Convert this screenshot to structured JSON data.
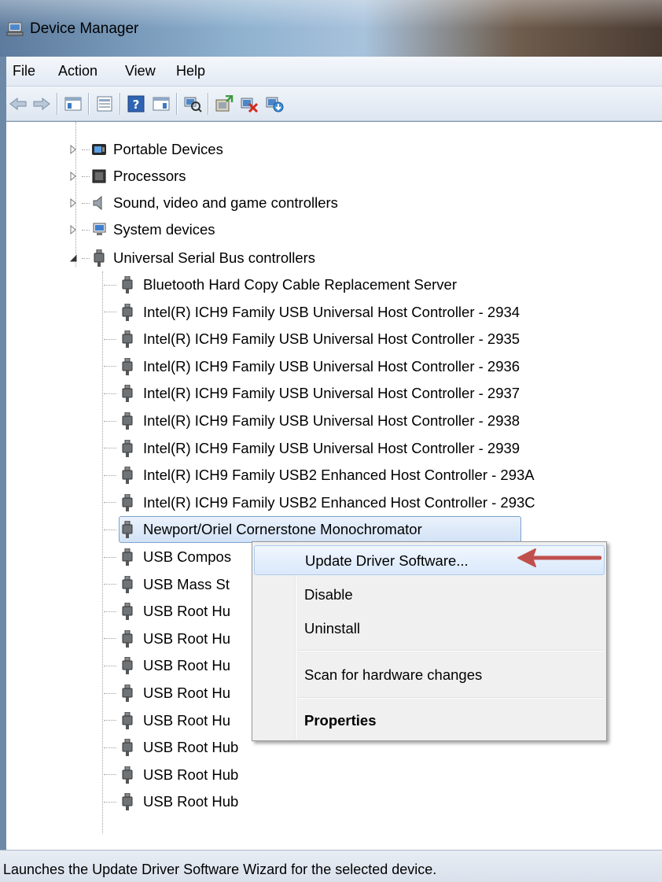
{
  "window": {
    "title": "Device Manager"
  },
  "menubar": {
    "items": [
      "File",
      "Action",
      "View",
      "Help"
    ]
  },
  "toolbar": {
    "buttons": [
      "back-icon",
      "forward-icon",
      "show-hide-console-tree-icon",
      "properties-icon",
      "help-icon",
      "action-pane-icon",
      "scan-hardware-icon",
      "update-driver-icon",
      "uninstall-icon",
      "enable-device-icon"
    ]
  },
  "tree": {
    "categories": [
      {
        "label": "Portable Devices",
        "expanded": false
      },
      {
        "label": "Processors",
        "expanded": false
      },
      {
        "label": "Sound, video and game controllers",
        "expanded": false
      },
      {
        "label": "System devices",
        "expanded": false
      },
      {
        "label": "Universal Serial Bus controllers",
        "expanded": true
      }
    ],
    "usb_devices": [
      "Bluetooth Hard Copy Cable Replacement Server",
      "Intel(R) ICH9 Family USB Universal Host Controller - 2934",
      "Intel(R) ICH9 Family USB Universal Host Controller - 2935",
      "Intel(R) ICH9 Family USB Universal Host Controller - 2936",
      "Intel(R) ICH9 Family USB Universal Host Controller - 2937",
      "Intel(R) ICH9 Family USB Universal Host Controller - 2938",
      "Intel(R) ICH9 Family USB Universal Host Controller - 2939",
      "Intel(R) ICH9 Family USB2 Enhanced Host Controller - 293A",
      "Intel(R) ICH9 Family USB2 Enhanced Host Controller - 293C",
      "Newport/Oriel Cornerstone Monochromator",
      "USB Compos",
      "USB Mass St",
      "USB Root Hu",
      "USB Root Hu",
      "USB Root Hu",
      "USB Root Hu",
      "USB Root Hu",
      "USB Root Hub",
      "USB Root Hub",
      "USB Root Hub"
    ],
    "selected": "Newport/Oriel Cornerstone Monochromator"
  },
  "context_menu": {
    "items": [
      {
        "label": "Update Driver Software...",
        "highlighted": true,
        "bold": false
      },
      {
        "label": "Disable",
        "highlighted": false,
        "bold": false
      },
      {
        "label": "Uninstall",
        "highlighted": false,
        "bold": false
      },
      {
        "label": "Scan for hardware changes",
        "highlighted": false,
        "bold": false
      },
      {
        "label": "Properties",
        "highlighted": false,
        "bold": true
      }
    ]
  },
  "annotation": {
    "arrow_color": "#c0504d"
  },
  "statusbar": {
    "text": "Launches the Update Driver Software Wizard for the selected device."
  }
}
